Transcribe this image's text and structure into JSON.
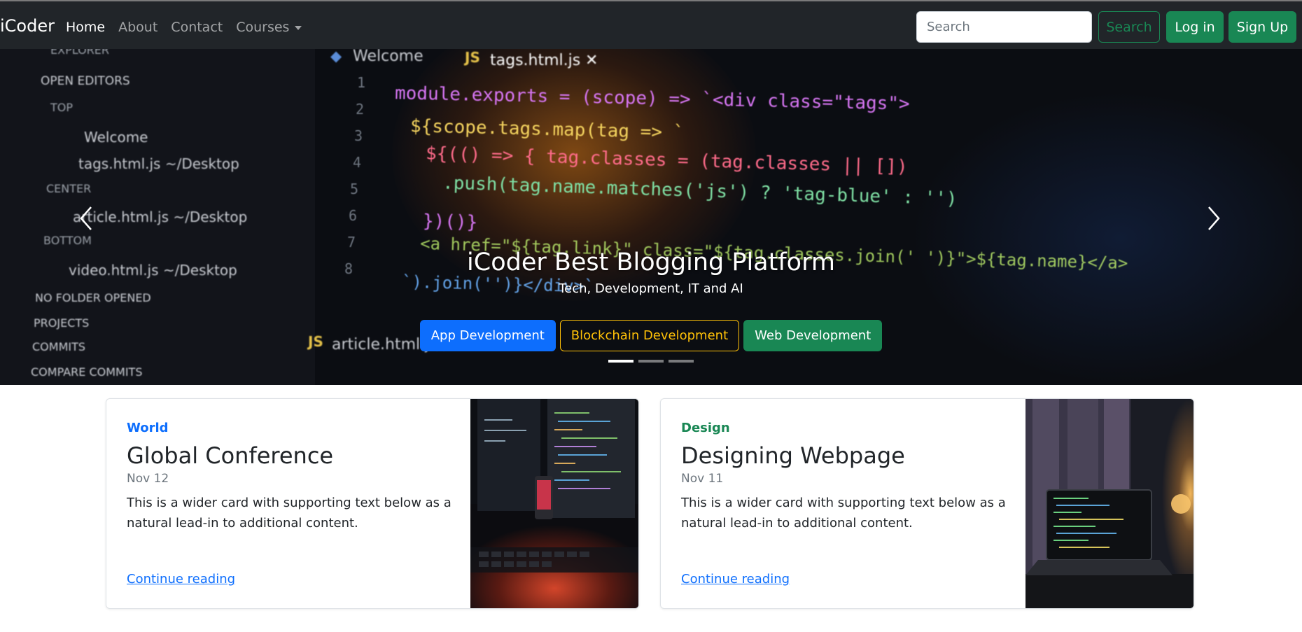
{
  "navbar": {
    "brand": "iCoder",
    "links": [
      {
        "label": "Home",
        "active": true
      },
      {
        "label": "About"
      },
      {
        "label": "Contact"
      },
      {
        "label": "Courses"
      }
    ],
    "search_placeholder": "Search",
    "search_button": "Search",
    "login_button": "Log in",
    "signup_button": "Sign Up"
  },
  "carousel": {
    "title": "iCoder Best Blogging Platform",
    "subtitle": "Tech, Development, IT and AI",
    "buttons": [
      "App Development",
      "Blockchain Development",
      "Web Development"
    ],
    "slide_count": 3,
    "active_slide": 1
  },
  "cards": [
    {
      "category": "World",
      "title": "Global Conference",
      "date": "Nov 12",
      "text": "This is a wider card with supporting text below as a natural lead-in to additional content.",
      "link": "Continue reading"
    },
    {
      "category": "Design",
      "title": "Designing Webpage",
      "date": "Nov 11",
      "text": "This is a wider card with supporting text below as a natural lead-in to additional content.",
      "link": "Continue reading"
    }
  ],
  "colors": {
    "navbar_bg": "#212529",
    "success": "#198754",
    "primary": "#0d6efd",
    "warning": "#ffc107"
  },
  "background_code": {
    "editor_tabs": [
      "Welcome",
      "tags.html.js",
      "article.html.js"
    ],
    "sidebar_lines": [
      "EXPLORER",
      "OPEN EDITORS",
      "TOP",
      "Welcome",
      "tags.html.js ~/Desktop",
      "CENTER",
      "article.html.js ~/Desktop",
      "BOTTOM",
      "video.html.js ~/Desktop",
      "NO FOLDER OPENED",
      "PROJECTS",
      "COMMITS",
      "COMPARE COMMITS"
    ],
    "code_lines": [
      "module.exports = (scope) => `<div class=\"tags\">",
      "${scope.tags.map(tag => `",
      "${(() => { tag.classes = (tag.classes || [])",
      ".push(tag.name.matches('js') ? 'tag-blue' : '')",
      "})()}",
      "<a href=\"${tag.link}\" class=\"${tag.classes.join(' ')}\">${tag.name}</a>",
      "`).join('')}</div>`"
    ],
    "line_numbers": [
      "1",
      "2",
      "3",
      "4",
      "5",
      "6",
      "7",
      "8"
    ]
  }
}
